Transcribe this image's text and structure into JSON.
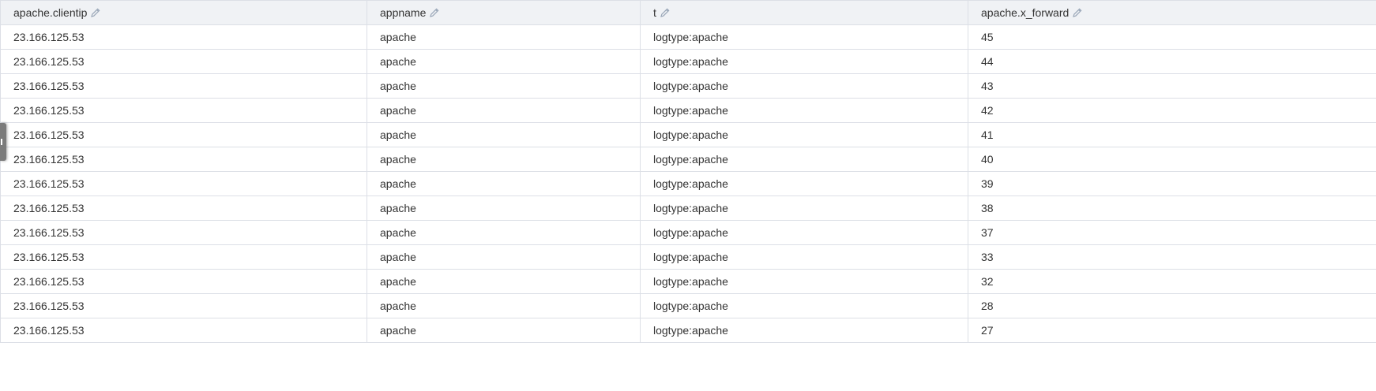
{
  "table": {
    "columns": [
      {
        "label": "apache.clientip",
        "editable": true
      },
      {
        "label": "appname",
        "editable": true
      },
      {
        "label": "t",
        "editable": true
      },
      {
        "label": "apache.x_forward",
        "editable": true
      }
    ],
    "rows": [
      [
        "23.166.125.53",
        "apache",
        "logtype:apache",
        "45"
      ],
      [
        "23.166.125.53",
        "apache",
        "logtype:apache",
        "44"
      ],
      [
        "23.166.125.53",
        "apache",
        "logtype:apache",
        "43"
      ],
      [
        "23.166.125.53",
        "apache",
        "logtype:apache",
        "42"
      ],
      [
        "23.166.125.53",
        "apache",
        "logtype:apache",
        "41"
      ],
      [
        "23.166.125.53",
        "apache",
        "logtype:apache",
        "40"
      ],
      [
        "23.166.125.53",
        "apache",
        "logtype:apache",
        "39"
      ],
      [
        "23.166.125.53",
        "apache",
        "logtype:apache",
        "38"
      ],
      [
        "23.166.125.53",
        "apache",
        "logtype:apache",
        "37"
      ],
      [
        "23.166.125.53",
        "apache",
        "logtype:apache",
        "33"
      ],
      [
        "23.166.125.53",
        "apache",
        "logtype:apache",
        "32"
      ],
      [
        "23.166.125.53",
        "apache",
        "logtype:apache",
        "28"
      ],
      [
        "23.166.125.53",
        "apache",
        "logtype:apache",
        "27"
      ]
    ]
  },
  "icons": {
    "edit": "pencil-icon",
    "side_handle": "drag-handle-icon"
  },
  "colors": {
    "header_bg": "#f0f2f5",
    "border": "#dcdfe6",
    "text": "#333333",
    "icon": "#9aa7b8"
  }
}
